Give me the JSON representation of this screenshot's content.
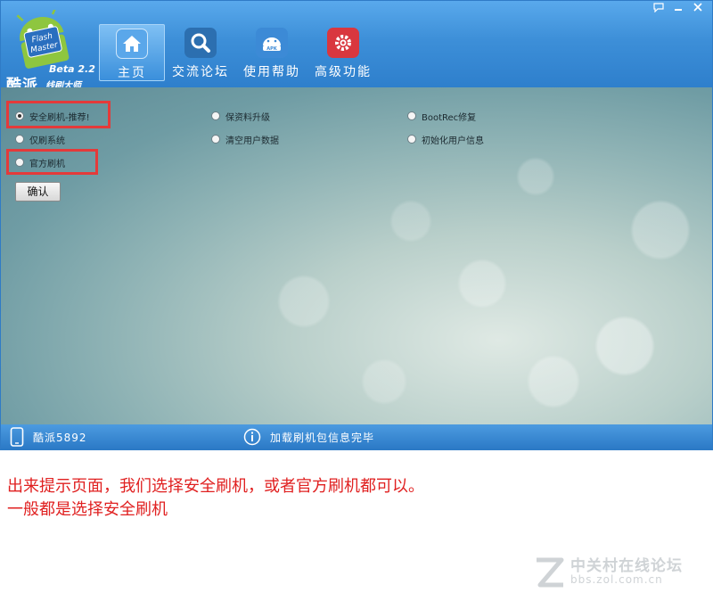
{
  "app": {
    "logo": {
      "name_cn": "酷派",
      "name_en": "Flash Master",
      "version": "Beta 2.2",
      "tagline": "线刷大师"
    },
    "window_controls": [
      "comment-icon",
      "minimize-icon",
      "close-icon"
    ]
  },
  "nav": {
    "items": [
      {
        "label": "主页",
        "icon": "home-icon",
        "active": true,
        "color": "#5aa7ea"
      },
      {
        "label": "交流论坛",
        "icon": "search-icon",
        "active": false,
        "color": "#2c6fb0"
      },
      {
        "label": "使用帮助",
        "icon": "apk-icon",
        "active": false,
        "color": "#3c8ad6"
      },
      {
        "label": "高级功能",
        "icon": "gear-icon",
        "active": false,
        "color": "#d9373f"
      }
    ]
  },
  "options": {
    "col1": [
      {
        "label": "安全刷机-推荐!",
        "selected": true
      },
      {
        "label": "仅刷系统",
        "selected": false
      },
      {
        "label": "官方刷机",
        "selected": false
      }
    ],
    "col2": [
      {
        "label": "保资料升级",
        "selected": false
      },
      {
        "label": "清空用户数据",
        "selected": false
      }
    ],
    "col3": [
      {
        "label": "BootRec修复",
        "selected": false
      },
      {
        "label": "初始化用户信息",
        "selected": false
      }
    ],
    "confirm_label": "确认"
  },
  "status": {
    "device": "酷派5892",
    "message": "加载刷机包信息完毕"
  },
  "annotation": {
    "line1": "出来提示页面，我们选择安全刷机，或者官方刷机都可以。",
    "line2": "一般都是选择安全刷机"
  },
  "watermark": {
    "text_cn": "中关村在线论坛",
    "url": "bbs.zol.com.cn"
  },
  "colors": {
    "highlight": "#e43a3a",
    "title_bar": "#3d8fd8",
    "annotation": "#e02020"
  }
}
